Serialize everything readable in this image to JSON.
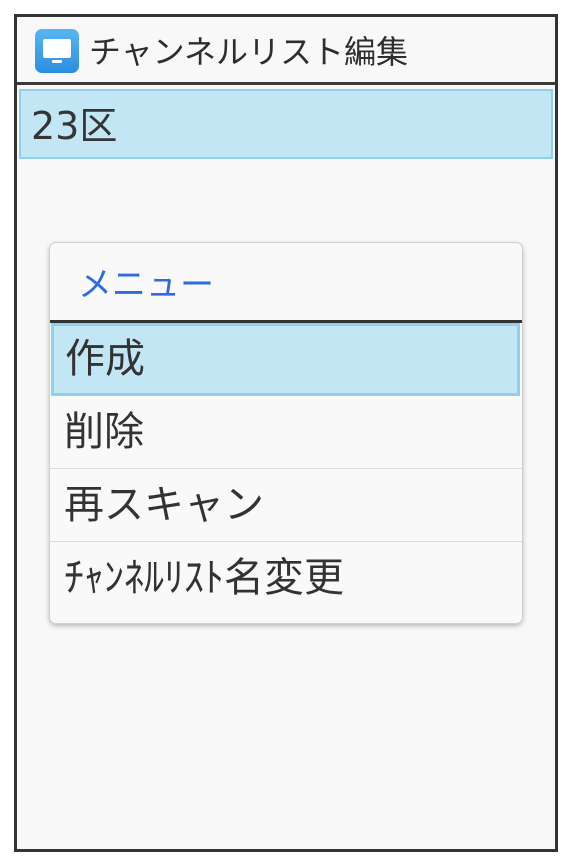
{
  "header": {
    "title": "チャンネルリスト編集",
    "icon": "tv-icon"
  },
  "list": {
    "selected_item": "23区"
  },
  "menu": {
    "title": "メニュー",
    "items": [
      {
        "label": "作成",
        "selected": true
      },
      {
        "label": "削除",
        "selected": false
      },
      {
        "label": "再スキャン",
        "selected": false
      },
      {
        "label": "ﾁｬﾝﾈﾙﾘｽﾄ名変更",
        "selected": false
      }
    ]
  },
  "colors": {
    "selection_bg": "#c3e6f5",
    "selection_border": "#8fd0ec",
    "accent_title": "#2f6ae0",
    "icon_blue": "#2a8ee0"
  }
}
